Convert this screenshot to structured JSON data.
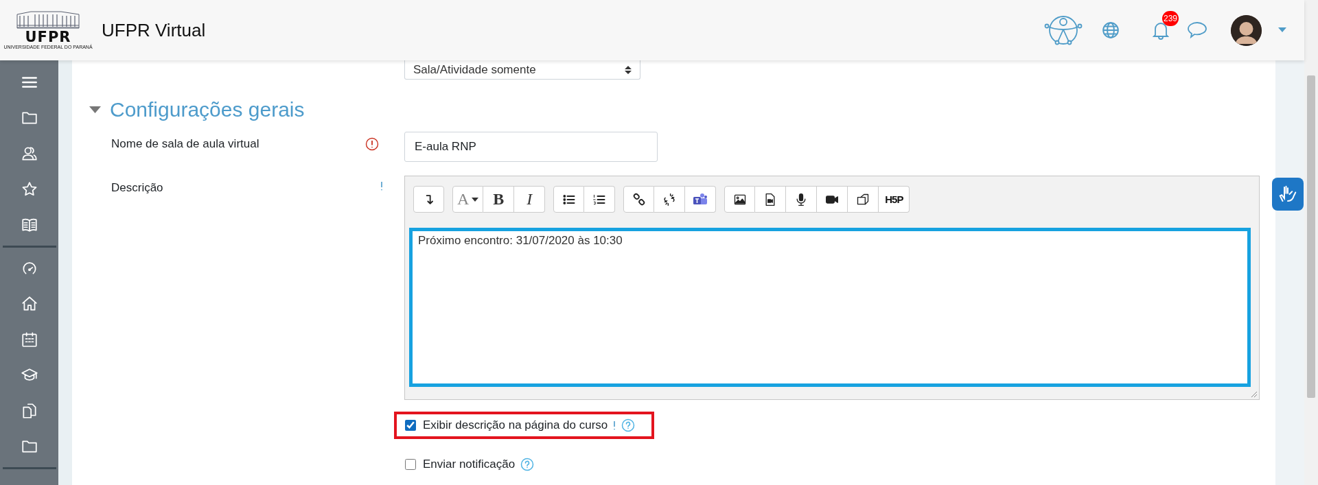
{
  "header": {
    "logo": {
      "wordmark": "UFPR",
      "tagline": "UNIVERSIDADE FEDERAL DO PARANÁ"
    },
    "title": "UFPR Virtual",
    "notification_count": "239"
  },
  "sidebar": {
    "items": [
      {
        "kind": "menu"
      },
      {
        "kind": "folder"
      },
      {
        "kind": "users"
      },
      {
        "kind": "star"
      },
      {
        "kind": "book"
      },
      {
        "kind": "divider"
      },
      {
        "kind": "dashboard"
      },
      {
        "kind": "home"
      },
      {
        "kind": "calendar"
      },
      {
        "kind": "graduation"
      },
      {
        "kind": "files"
      },
      {
        "kind": "folder"
      },
      {
        "kind": "divider"
      }
    ]
  },
  "form": {
    "instance_type": {
      "value": "Sala/Atividade somente"
    },
    "section": {
      "title": "Configurações gerais",
      "expanded": true
    },
    "name_field": {
      "label": "Nome de sala de aula virtual",
      "value": "E-aula RNP",
      "required": true
    },
    "description": {
      "label": "Descrição",
      "content": "Próximo encontro: 31/07/2020 às 10:30",
      "toolbar": [
        {
          "buttons": [
            {
              "kind": "collapse"
            }
          ]
        },
        {
          "buttons": [
            {
              "kind": "font-color",
              "label": "A"
            },
            {
              "kind": "bold",
              "label": "B"
            },
            {
              "kind": "italic",
              "label": "I"
            }
          ]
        },
        {
          "buttons": [
            {
              "kind": "bullet-list"
            },
            {
              "kind": "numbered-list"
            }
          ]
        },
        {
          "buttons": [
            {
              "kind": "link"
            },
            {
              "kind": "unlink"
            },
            {
              "kind": "teams"
            }
          ]
        },
        {
          "buttons": [
            {
              "kind": "image"
            },
            {
              "kind": "media"
            },
            {
              "kind": "record-audio"
            },
            {
              "kind": "record-video"
            },
            {
              "kind": "copy"
            },
            {
              "kind": "h5p",
              "label": "H5P"
            }
          ]
        }
      ]
    },
    "checkboxes": [
      {
        "label": "Exibir descrição na página do curso",
        "checked": true,
        "highlighted": true,
        "advanced": true
      },
      {
        "label": "Enviar notificação",
        "checked": false,
        "highlighted": false,
        "advanced": false
      }
    ]
  }
}
